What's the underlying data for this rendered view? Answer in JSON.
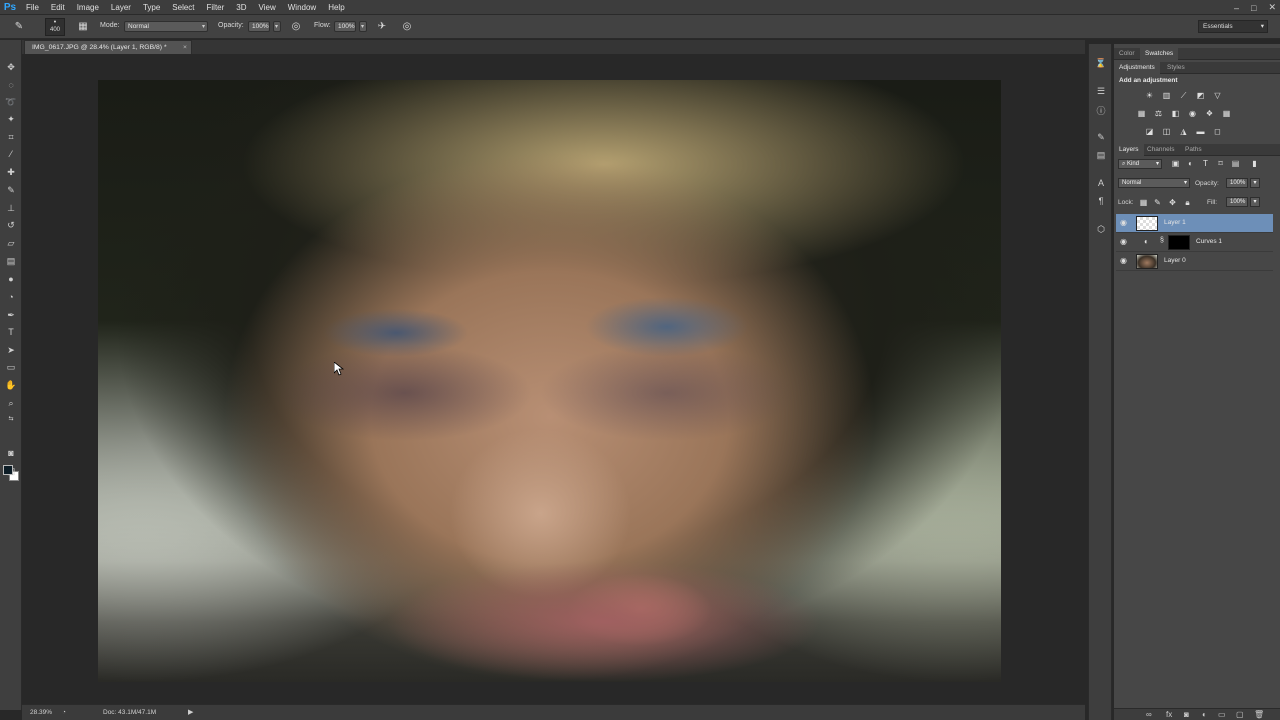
{
  "app": {
    "logo": "Ps",
    "menu": [
      "File",
      "Edit",
      "Image",
      "Layer",
      "Type",
      "Select",
      "Filter",
      "3D",
      "View",
      "Window",
      "Help"
    ],
    "window_controls": [
      "–",
      "□",
      "✕"
    ]
  },
  "options": {
    "brush_size": "400",
    "mode_label": "Mode:",
    "mode_value": "Normal",
    "opacity_label": "Opacity:",
    "opacity_value": "100%",
    "flow_label": "Flow:",
    "flow_value": "100%",
    "workspace": "Essentials"
  },
  "document": {
    "tab_title": "IMG_0617.JPG @ 28.4% (Layer 1, RGB/8) *",
    "close": "×",
    "zoom": "28.39%",
    "doc_size": "Doc: 43.1M/47.1M"
  },
  "panels": {
    "top_tabs": [
      "Color",
      "Swatches"
    ],
    "adj_tabs": [
      "Adjustments",
      "Styles"
    ],
    "add_adjustment": "Add an adjustment",
    "layers_tabs": [
      "Layers",
      "Channels",
      "Paths"
    ],
    "kind_filter": "Kind",
    "blend_mode": "Normal",
    "opacity_label": "Opacity:",
    "opacity_value": "100%",
    "lock_label": "Lock:",
    "fill_label": "Fill:",
    "fill_value": "100%"
  },
  "layers": [
    {
      "name": "Layer 1",
      "selected": true
    },
    {
      "name": "Curves 1",
      "selected": false
    },
    {
      "name": "Layer 0",
      "selected": false
    }
  ],
  "colors": {
    "foreground": "#0d1d26",
    "background": "#ffffff",
    "selection": "#6d8fb8"
  }
}
